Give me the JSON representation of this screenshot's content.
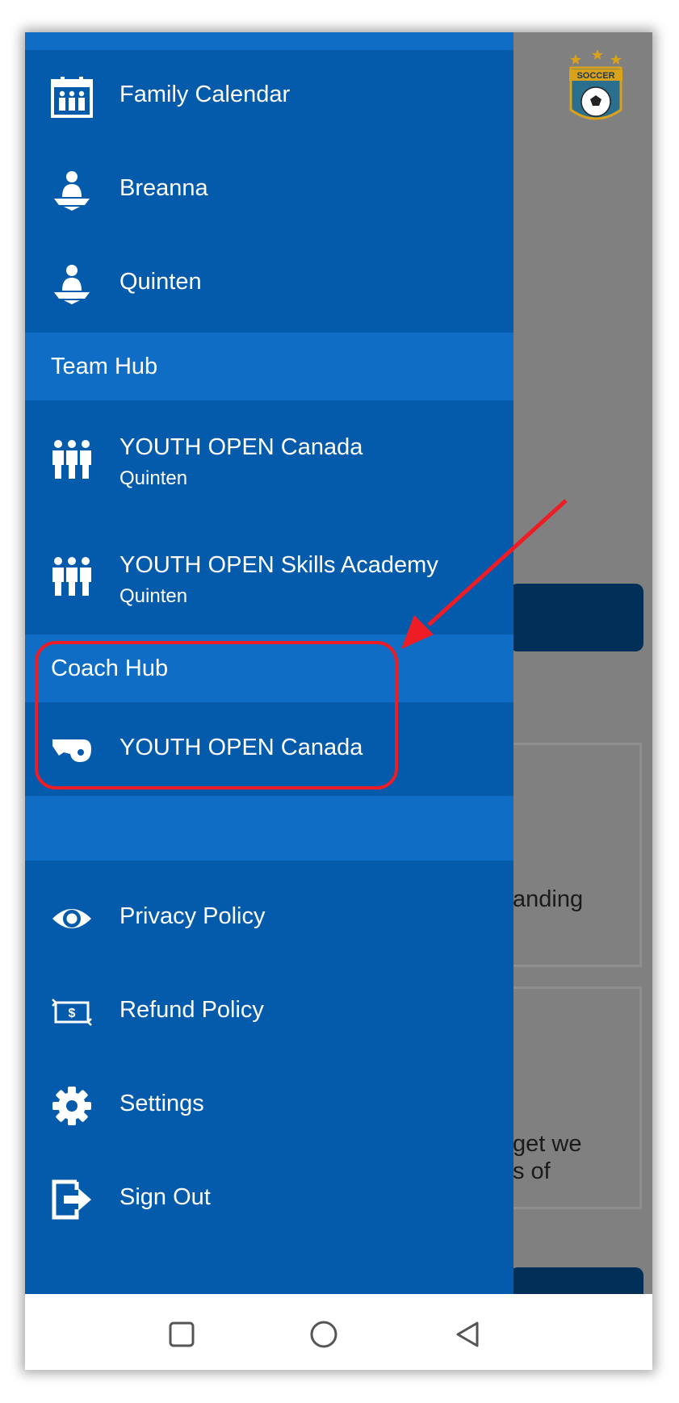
{
  "drawer": {
    "family_items": [
      {
        "label": "Family Calendar",
        "icon": "calendar-family-icon"
      },
      {
        "label": "Breanna",
        "icon": "person-icon"
      },
      {
        "label": "Quinten",
        "icon": "person-icon"
      }
    ],
    "team_hub": {
      "header": "Team Hub",
      "items": [
        {
          "label": "YOUTH OPEN Canada",
          "sub": "Quinten",
          "icon": "team-icon"
        },
        {
          "label": "YOUTH OPEN Skills Academy",
          "sub": "Quinten",
          "icon": "team-icon"
        }
      ]
    },
    "coach_hub": {
      "header": "Coach Hub",
      "items": [
        {
          "label": "YOUTH OPEN Canada",
          "icon": "whistle-icon"
        }
      ]
    },
    "footer_items": [
      {
        "label": "Privacy Policy",
        "icon": "eye-icon"
      },
      {
        "label": "Refund Policy",
        "icon": "money-icon"
      },
      {
        "label": "Settings",
        "icon": "gear-icon"
      },
      {
        "label": "Sign Out",
        "icon": "sign-out-icon"
      }
    ]
  },
  "background": {
    "logo_text": "SOCCER",
    "card1_text": "anding",
    "card2_line1": "get we",
    "card2_line2": "s of"
  },
  "colors": {
    "drawer": "#045aab",
    "section": "#0f6dc6",
    "annotation": "#ee1c25"
  },
  "navbar": {
    "buttons": [
      "recents-button",
      "home-button",
      "back-button"
    ]
  }
}
